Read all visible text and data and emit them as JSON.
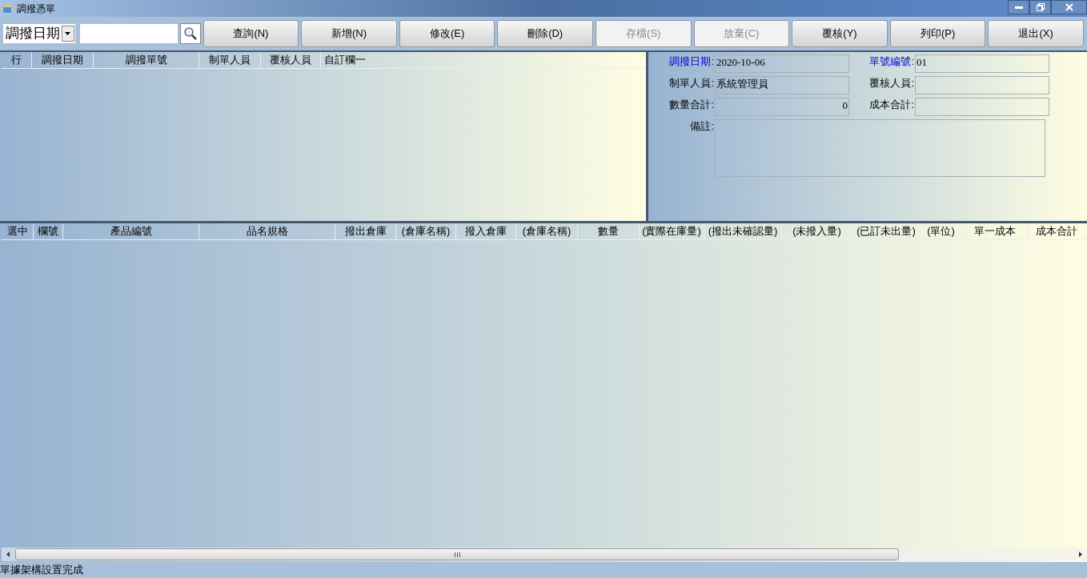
{
  "window": {
    "title": "調撥憑單"
  },
  "toolbar": {
    "search_field": "調撥日期",
    "buttons": [
      {
        "label": "查詢(N)",
        "disabled": false
      },
      {
        "label": "新增(N)",
        "disabled": false
      },
      {
        "label": "修改(E)",
        "disabled": false
      },
      {
        "label": "刪除(D)",
        "disabled": false
      },
      {
        "label": "存檔(S)",
        "disabled": true
      },
      {
        "label": "放棄(C)",
        "disabled": true
      },
      {
        "label": "覆核(Y)",
        "disabled": false
      },
      {
        "label": "列印(P)",
        "disabled": false
      },
      {
        "label": "退出(X)",
        "disabled": false
      }
    ]
  },
  "list": {
    "columns": [
      "行",
      "調撥日期",
      "調撥單號",
      "制單人員",
      "覆核人員",
      "自訂欄一"
    ]
  },
  "form": {
    "fields": [
      {
        "label": "調撥日期:",
        "value": "2020-10-06",
        "highlighted": true,
        "kind": "text"
      },
      {
        "label": "單號編號:",
        "value": "01",
        "highlighted": true,
        "kind": "text"
      },
      {
        "label": "制單人員:",
        "value": "系統管理員",
        "highlighted": false,
        "kind": "text"
      },
      {
        "label": "覆核人員:",
        "highlighted": false,
        "kind": "text"
      },
      {
        "label": "數量合計:",
        "value": "0",
        "highlighted": false,
        "kind": "number"
      },
      {
        "label": "成本合計:",
        "highlighted": false,
        "kind": "number"
      }
    ],
    "note": {
      "label": "備註:"
    }
  },
  "grid": {
    "columns": [
      "選中",
      "欄號",
      "產品編號",
      "品名規格",
      "撥出倉庫",
      "(倉庫名稱)",
      "撥入倉庫",
      "(倉庫名稱)",
      "數量",
      "(實際在庫量)",
      "(撥出未確認量)",
      "(未撥入量)",
      "(已訂未出量)",
      "(單位)",
      "單一成本",
      "成本合計"
    ]
  },
  "status_bar": "單據架構設置完成"
}
